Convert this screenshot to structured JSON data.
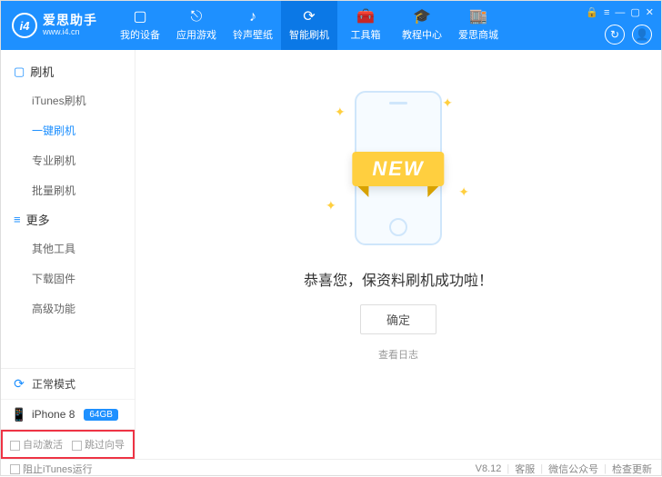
{
  "app": {
    "title": "爱思助手",
    "subtitle": "www.i4.cn",
    "logo_text": "i4"
  },
  "header_tabs": [
    {
      "icon": "▢",
      "label": "我的设备"
    },
    {
      "icon": "⎋",
      "label": "应用游戏"
    },
    {
      "icon": "♪",
      "label": "铃声壁纸"
    },
    {
      "icon": "⟳",
      "label": "智能刷机"
    },
    {
      "icon": "🧰",
      "label": "工具箱"
    },
    {
      "icon": "🎓",
      "label": "教程中心"
    },
    {
      "icon": "🏬",
      "label": "爱思商城"
    }
  ],
  "header_icons": {
    "refresh": "↻",
    "user": "👤",
    "lock": "🔒",
    "menu": "≡",
    "min": "—",
    "max": "▢",
    "close": "✕"
  },
  "sidebar": {
    "group1": {
      "icon": "▢",
      "label": "刷机"
    },
    "items1": [
      "iTunes刷机",
      "一键刷机",
      "专业刷机",
      "批量刷机"
    ],
    "group2": {
      "icon": "≡",
      "label": "更多"
    },
    "items2": [
      "其他工具",
      "下载固件",
      "高级功能"
    ]
  },
  "status": {
    "mode_icon": "⟳",
    "mode_label": "正常模式",
    "device_icon": "📱",
    "device_name": "iPhone 8",
    "device_storage": "64GB"
  },
  "checks": {
    "auto_activate": "自动激活",
    "skip_guide": "跳过向导"
  },
  "main": {
    "ribbon": "NEW",
    "success": "恭喜您，保资料刷机成功啦！",
    "ok": "确定",
    "log": "查看日志"
  },
  "footer": {
    "block_itunes": "阻止iTunes运行",
    "version": "V8.12",
    "support": "客服",
    "wechat": "微信公众号",
    "update": "检查更新"
  }
}
